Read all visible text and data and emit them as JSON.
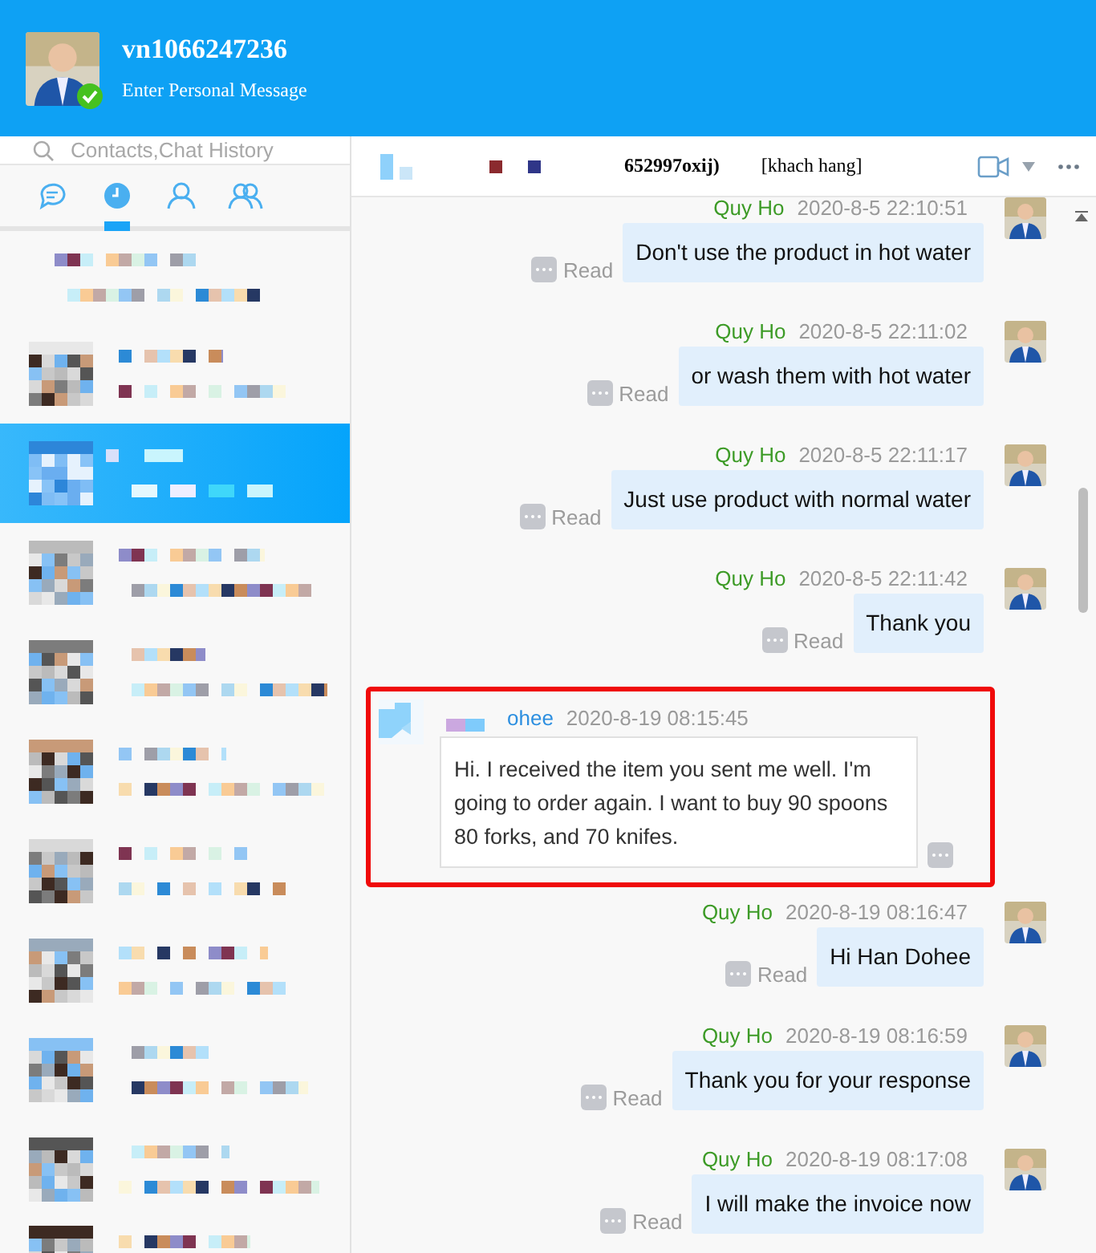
{
  "profile": {
    "name": "vn1066247236",
    "message": "Enter Personal Message",
    "online": true
  },
  "search": {
    "placeholder": "Contacts,Chat History"
  },
  "tabs": [
    {
      "kind": "chat",
      "selected": false
    },
    {
      "kind": "recent",
      "selected": true
    },
    {
      "kind": "contact",
      "selected": false
    },
    {
      "kind": "group",
      "selected": false
    }
  ],
  "contacts": [
    {
      "selected": false
    },
    {
      "selected": false
    },
    {
      "selected": true
    },
    {
      "selected": false
    },
    {
      "selected": false
    },
    {
      "selected": false
    },
    {
      "selected": false
    },
    {
      "selected": false
    },
    {
      "selected": false
    },
    {
      "selected": false
    },
    {
      "selected": false
    }
  ],
  "chat": {
    "title": "652997oxij)",
    "tag": "[khach hang]"
  },
  "messages": [
    {
      "kind": "sent",
      "sender": "Quy Ho",
      "time": "2020-8-5 22:10:51",
      "text": "Don't use the product in hot water",
      "status": "Read",
      "highlighted": false
    },
    {
      "kind": "sent",
      "sender": "Quy Ho",
      "time": "2020-8-5 22:11:02",
      "text": "or wash them with hot water",
      "status": "Read",
      "highlighted": false
    },
    {
      "kind": "sent",
      "sender": "Quy Ho",
      "time": "2020-8-5 22:11:17",
      "text": "Just use product with normal water",
      "status": "Read",
      "highlighted": false
    },
    {
      "kind": "sent",
      "sender": "Quy Ho",
      "time": "2020-8-5 22:11:42",
      "text": "Thank you",
      "status": "Read",
      "highlighted": false
    },
    {
      "kind": "received",
      "sender": "ohee",
      "time": "2020-8-19 08:15:45",
      "text": "Hi. I received the item you sent me well. I'm going to order again. I want to buy 90 spoons 80 forks, and 70 knifes.",
      "highlighted": true
    },
    {
      "kind": "sent",
      "sender": "Quy Ho",
      "time": "2020-8-19 08:16:47",
      "text": "Hi Han Dohee",
      "status": "Read",
      "highlighted": false
    },
    {
      "kind": "sent",
      "sender": "Quy Ho",
      "time": "2020-8-19 08:16:59",
      "text": "Thank you for your response",
      "status": "Read",
      "highlighted": false
    },
    {
      "kind": "sent",
      "sender": "Quy Ho",
      "time": "2020-8-19 08:17:08",
      "text": "I will make the invoice now",
      "status": "Read",
      "highlighted": false
    }
  ]
}
